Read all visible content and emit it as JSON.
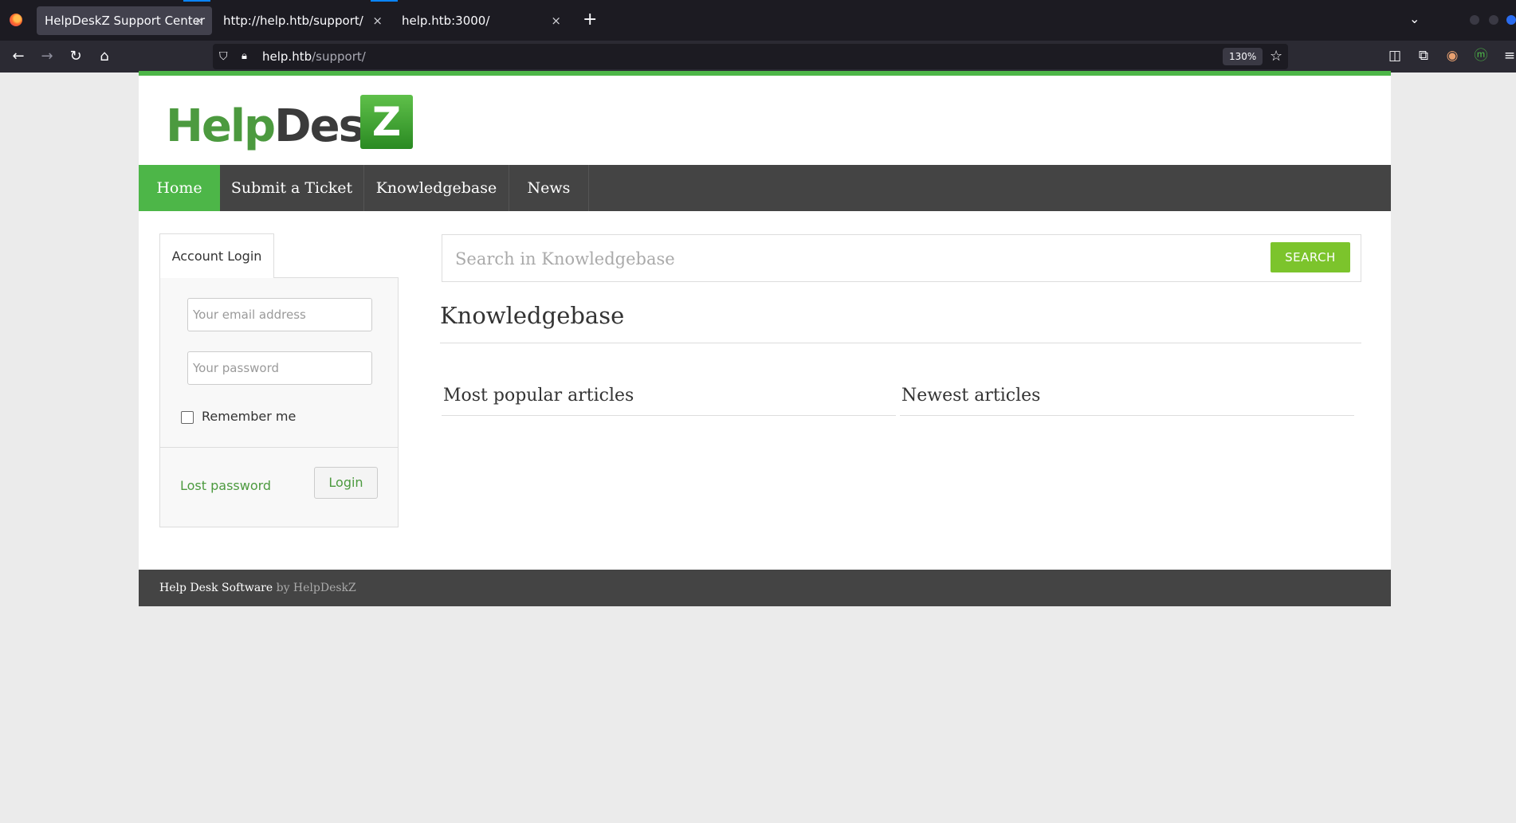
{
  "browser": {
    "tabs": [
      {
        "title": "HelpDeskZ Support Center",
        "active": true
      },
      {
        "title": "http://help.htb/support/",
        "active": false
      },
      {
        "title": "help.htb:3000/",
        "active": false
      }
    ],
    "close_glyph": "×",
    "new_tab_glyph": "+",
    "url_host": "help.htb",
    "url_path": "/support/",
    "zoom": "130%",
    "icons": [
      "back-icon",
      "forward-icon",
      "reload-icon",
      "home-icon",
      "shield-icon",
      "lock-icon",
      "bookmark-star-icon",
      "pocket-icon",
      "extensions-icon",
      "menu-icon"
    ]
  },
  "site": {
    "logo": {
      "part1": "Help",
      "part2": "Desk",
      "box_letter": "Z"
    },
    "accent_color": "#4db648",
    "nav": [
      {
        "label": "Home",
        "active": true
      },
      {
        "label": "Submit a Ticket",
        "active": false
      },
      {
        "label": "Knowledgebase",
        "active": false
      },
      {
        "label": "News",
        "active": false
      }
    ]
  },
  "login": {
    "tab_label": "Account Login",
    "email_placeholder": "Your email address",
    "password_placeholder": "Your password",
    "remember_label": "Remember me",
    "lost_password": "Lost password",
    "login_button": "Login"
  },
  "search": {
    "placeholder": "Search in Knowledgebase",
    "button": "SEARCH"
  },
  "kb": {
    "title": "Knowledgebase",
    "popular": "Most popular articles",
    "newest": "Newest articles"
  },
  "footer": {
    "main": "Help Desk Software",
    "by": " by HelpDeskZ"
  }
}
